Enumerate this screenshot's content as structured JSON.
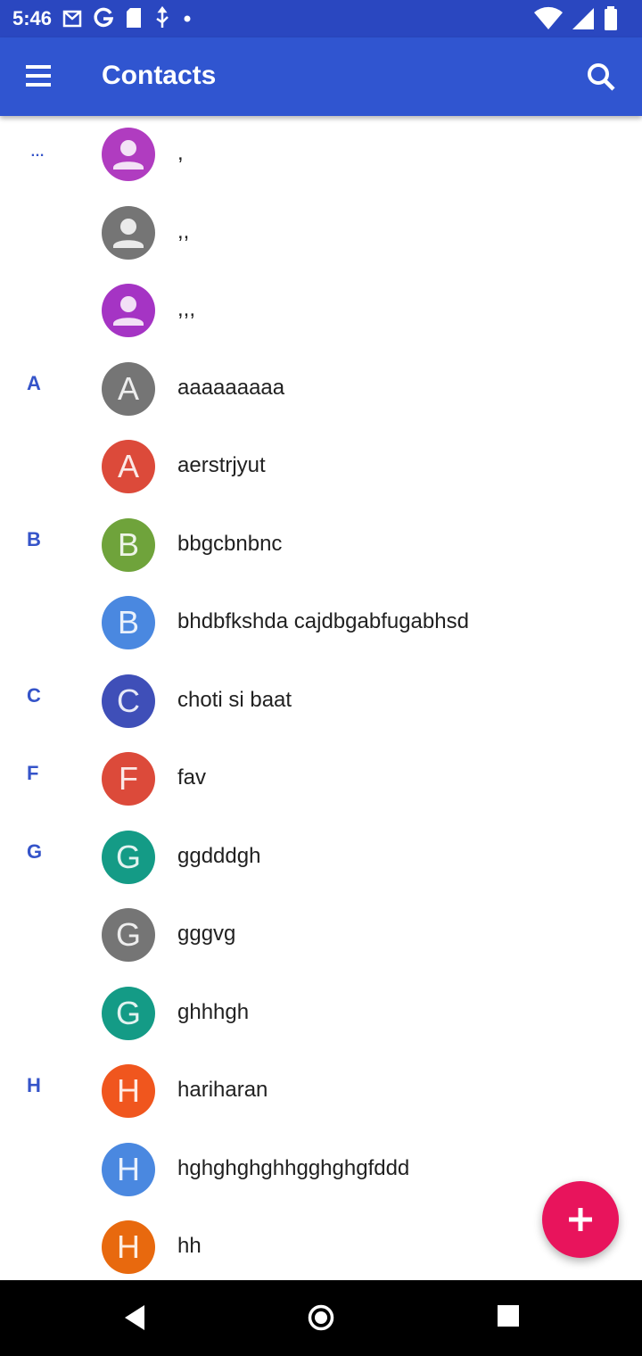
{
  "status_bar": {
    "time": "5:46",
    "notification_icons": [
      "gmail-icon",
      "google-icon",
      "sd-card-icon",
      "usb-icon",
      "dot-icon"
    ],
    "system_icons": [
      "wifi-icon",
      "signal-icon",
      "battery-icon"
    ]
  },
  "app_bar": {
    "title": "Contacts",
    "menu_icon": "hamburger-menu-icon",
    "search_icon": "search-icon"
  },
  "colors": {
    "status_bar": "#2a47c0",
    "app_bar": "#3055d0",
    "section_letter": "#3554c9",
    "fab": "#e8145c"
  },
  "contacts": [
    {
      "section": "…",
      "name": ",",
      "avatar": "",
      "color": "#b03cc0"
    },
    {
      "section": "",
      "name": ",,",
      "avatar": "",
      "color": "#757575"
    },
    {
      "section": "",
      "name": ",,,",
      "avatar": "",
      "color": "#a534c4"
    },
    {
      "section": "A",
      "name": "aaaaaaaaa",
      "avatar": "A",
      "color": "#757575"
    },
    {
      "section": "",
      "name": "aerstrjyut",
      "avatar": "A",
      "color": "#dc4a3a"
    },
    {
      "section": "B",
      "name": "bbgcbnbnc",
      "avatar": "B",
      "color": "#6fa33b"
    },
    {
      "section": "",
      "name": "bhdbfkshda cajdbgabfugabhsd",
      "avatar": "B",
      "color": "#4a88e0"
    },
    {
      "section": "C",
      "name": "choti si baat",
      "avatar": "C",
      "color": "#3f4fb8"
    },
    {
      "section": "F",
      "name": "fav",
      "avatar": "F",
      "color": "#dc4a3a"
    },
    {
      "section": "G",
      "name": "ggdddgh",
      "avatar": "G",
      "color": "#149b86"
    },
    {
      "section": "",
      "name": "gggvg",
      "avatar": "G",
      "color": "#757575"
    },
    {
      "section": "",
      "name": "ghhhgh",
      "avatar": "G",
      "color": "#149b86"
    },
    {
      "section": "H",
      "name": "hariharan",
      "avatar": "H",
      "color": "#f0561e"
    },
    {
      "section": "",
      "name": "hghghghghhgghghgfddd",
      "avatar": "H",
      "color": "#4a88e0"
    },
    {
      "section": "",
      "name": "hh",
      "avatar": "H",
      "color": "#e8690e"
    }
  ],
  "fab": {
    "icon": "plus-icon"
  },
  "nav_bar": {
    "icons": [
      "back-icon",
      "home-icon",
      "recents-icon"
    ]
  }
}
